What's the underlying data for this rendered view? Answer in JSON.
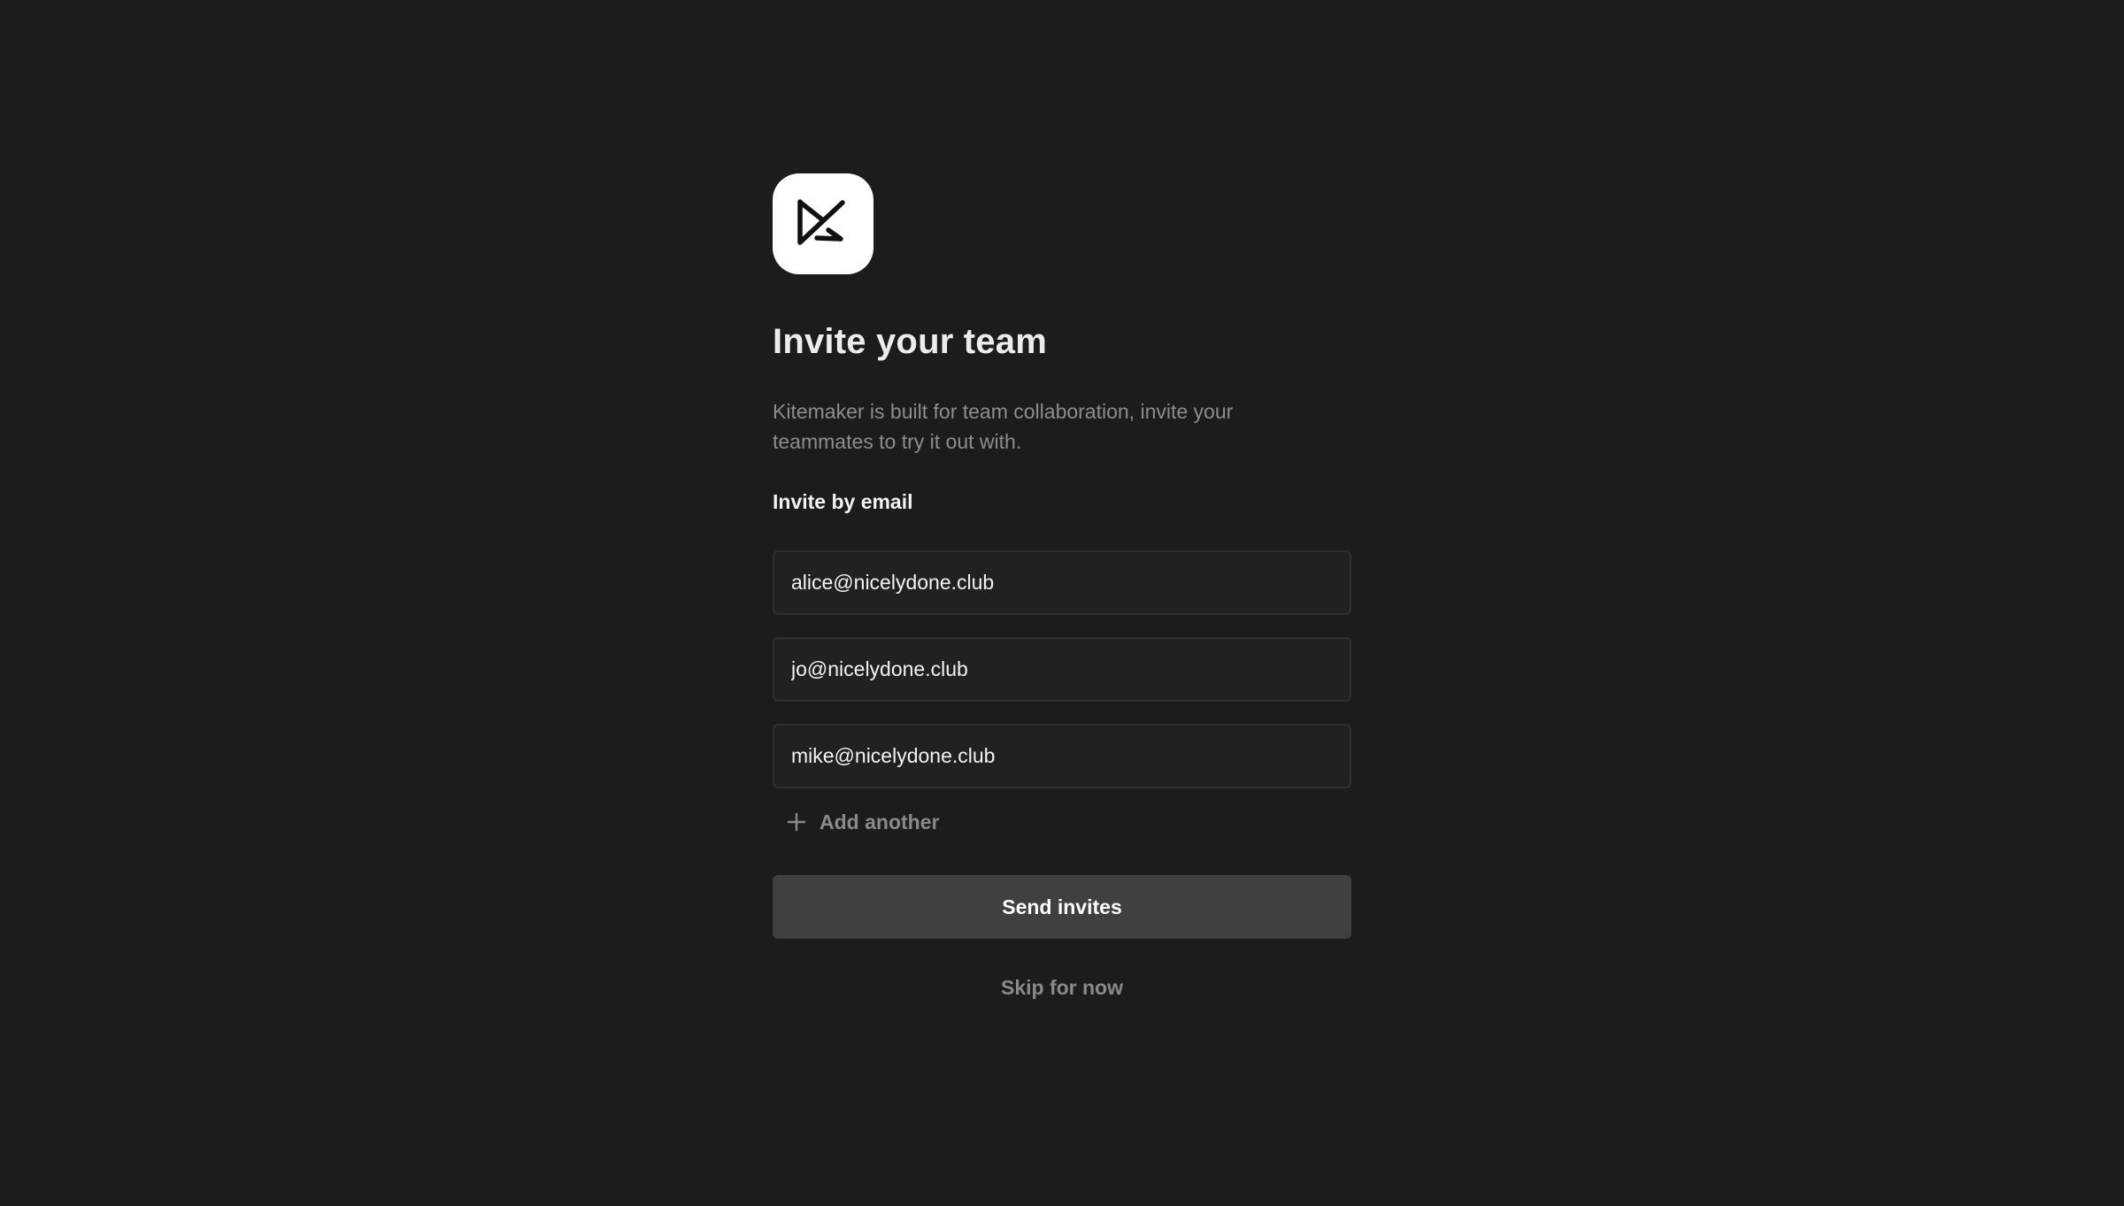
{
  "logo": {
    "icon": "kitemaker-logo-icon",
    "background": "#ffffff"
  },
  "title": "Invite your team",
  "description": "Kitemaker is built for team collaboration, invite your teammates to try it out with.",
  "invite_label": "Invite by email",
  "emails": [
    {
      "value": "alice@nicelydone.club"
    },
    {
      "value": "jo@nicelydone.club"
    },
    {
      "value": "mike@nicelydone.club"
    }
  ],
  "add_another": {
    "label": "Add another",
    "icon": "plus-icon"
  },
  "send_button": {
    "label": "Send invites"
  },
  "skip_link": {
    "label": "Skip for now"
  },
  "colors": {
    "background": "#1c1c1c",
    "field_background": "#212121",
    "field_border": "#2f2f2f",
    "button_background": "#404040",
    "muted_text": "#8a8a8a"
  }
}
